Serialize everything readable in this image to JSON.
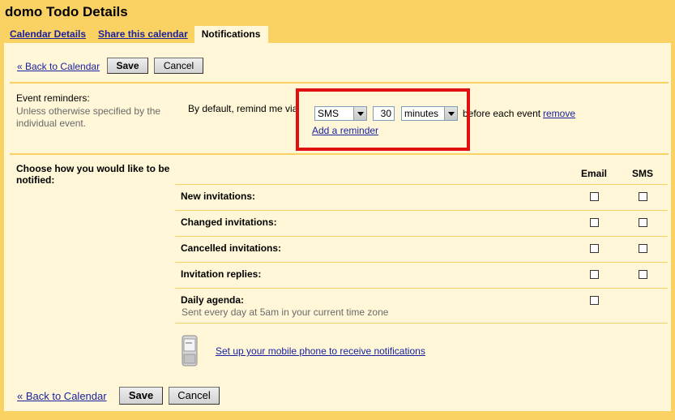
{
  "header": {
    "title": "domo Todo Details"
  },
  "tabs": [
    {
      "label": "Calendar Details"
    },
    {
      "label": "Share this calendar"
    },
    {
      "label": "Notifications"
    }
  ],
  "toolbar_top": {
    "back_label": "« Back to Calendar",
    "save_label": "Save",
    "cancel_label": "Cancel"
  },
  "event_reminders": {
    "title": "Event reminders:",
    "description": "Unless otherwise specified by the individual event.",
    "default_text": "By default, remind me via",
    "method": "SMS",
    "amount": "30",
    "unit": "minutes",
    "after_text": "before each event",
    "remove_label": "remove",
    "add_label": "Add a reminder"
  },
  "notify": {
    "title": "Choose how you would like to be notified:",
    "col_email": "Email",
    "col_sms": "SMS",
    "rows": [
      {
        "label": "New invitations:",
        "email": false,
        "sms": false
      },
      {
        "label": "Changed invitations:",
        "email": false,
        "sms": false
      },
      {
        "label": "Cancelled invitations:",
        "email": false,
        "sms": false
      },
      {
        "label": "Invitation replies:",
        "email": false,
        "sms": false
      },
      {
        "label": "Daily agenda:",
        "sub": "Sent every day at 5am in your current time zone",
        "email": false
      }
    ],
    "mobile_link": "Set up your mobile phone to receive notifications"
  },
  "toolbar_bottom": {
    "back_label": "« Back to Calendar",
    "save_label": "Save",
    "cancel_label": "Cancel"
  },
  "colors": {
    "accent": "#fad163",
    "panel": "#fff7d7",
    "link": "#1a21a0",
    "highlight": "#e01010"
  }
}
